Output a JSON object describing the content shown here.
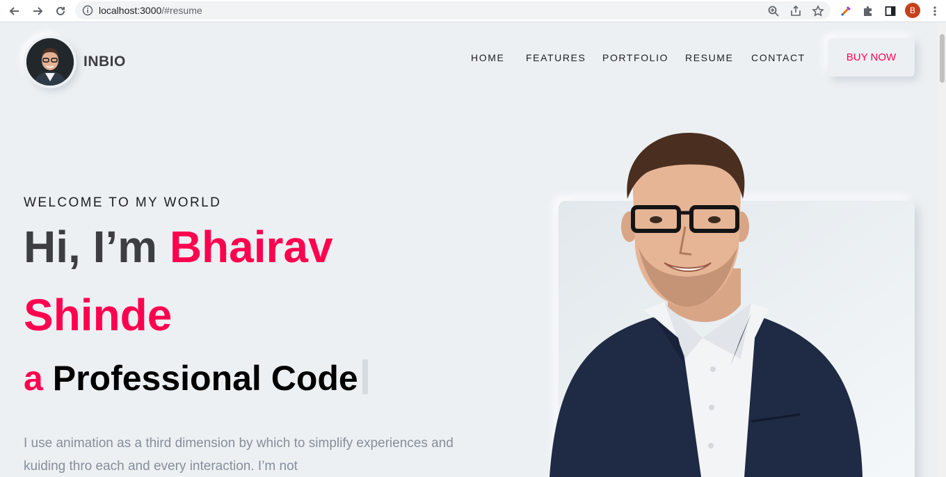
{
  "browser": {
    "url_host": "localhost:3000",
    "url_path": "/#resume",
    "profile_initial": "B",
    "icons": [
      "back-icon",
      "forward-icon",
      "reload-icon",
      "info-icon",
      "zoom-icon",
      "share-icon",
      "star-icon",
      "pen-extension-icon",
      "puzzle-icon",
      "sidepanel-icon",
      "menu-icon"
    ]
  },
  "header": {
    "brand": "INBIO",
    "nav": [
      "HOME",
      "FEATURES",
      "PORTFOLIO",
      "RESUME",
      "CONTACT"
    ],
    "buy_label": "BUY NOW"
  },
  "hero": {
    "welcome": "WELCOME TO MY WORLD",
    "greeting": "Hi, I’m",
    "first_name": "Bhairav",
    "last_name": "Shinde",
    "article": "a",
    "role": "Professional Code",
    "description": "I use animation as a third dimension by which to simplify experiences and kuiding thro each and every interaction. I’m not"
  },
  "colors": {
    "accent": "#ff014f",
    "background": "#ecf0f3",
    "heading": "#3c3e41",
    "body_text": "#878e99"
  }
}
